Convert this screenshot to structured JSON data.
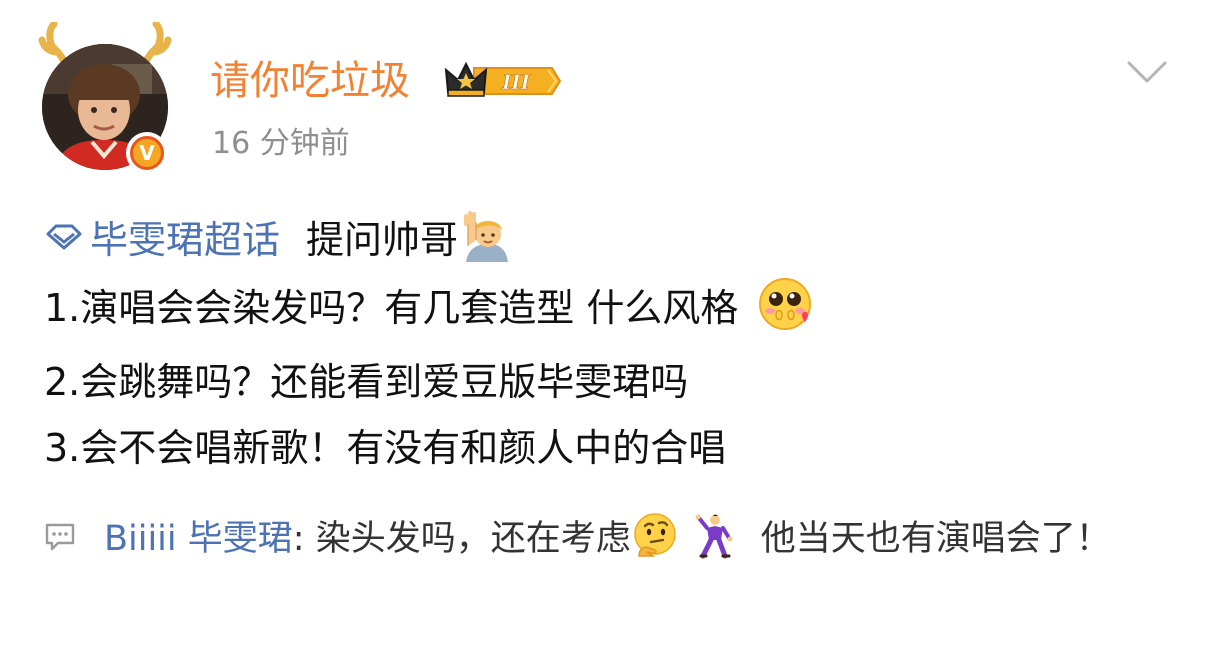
{
  "post": {
    "author": {
      "name": "请你吃垃圾",
      "vip_level": "III",
      "verified": "V"
    },
    "timestamp": "16 分钟前",
    "topic": {
      "name": "毕雯珺超话",
      "text": "提问帅哥"
    },
    "lines": [
      "1.演唱会会染发吗？有几套造型 什么风格",
      "2.会跳舞吗？还能看到爱豆版毕雯珺吗",
      "3.会不会唱新歌！有没有和颜人中的合唱"
    ],
    "icons": {
      "more": "chevron-down-icon",
      "topic": "diamond-topic-icon",
      "comment": "comment-bubble-icon"
    }
  },
  "comment": {
    "author": "Biiiii 毕雯珺",
    "separator": ": ",
    "text_part1": "染头发吗，还在考虑",
    "text_part2": "他当天也有演唱会了！"
  },
  "colors": {
    "username": "#f28232",
    "link": "#4d73b5",
    "timestamp": "#8f8f8f",
    "badge_orange": "#f6a623"
  }
}
